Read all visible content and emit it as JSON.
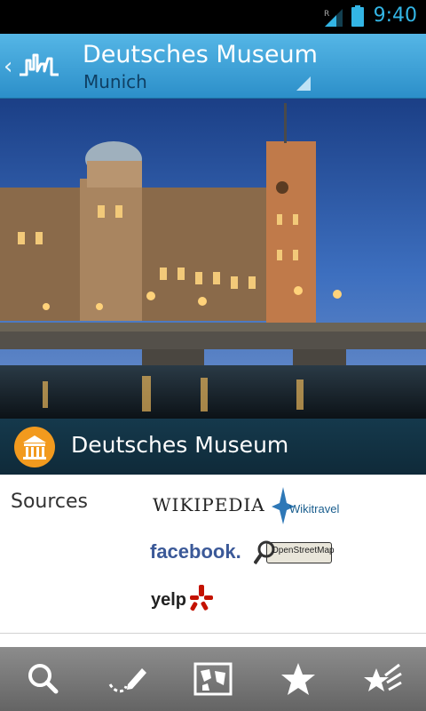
{
  "status_bar": {
    "time": "9:40",
    "roaming_label": "R"
  },
  "action_bar": {
    "title": "Deutsches Museum",
    "subtitle": "Munich"
  },
  "poi": {
    "name": "Deutsches Museum",
    "icon": "museum-icon"
  },
  "sources": {
    "label": "Sources",
    "items": [
      {
        "name": "wikipedia",
        "text": "WIKIPEDIA"
      },
      {
        "name": "wikitravel",
        "text": "Wikitravel"
      },
      {
        "name": "facebook",
        "text": "facebook."
      },
      {
        "name": "openstreetmap",
        "text": "OpenStreetMap"
      },
      {
        "name": "yelp",
        "text": "yelp"
      }
    ]
  },
  "bottom_tabs": [
    {
      "icon": "search-icon"
    },
    {
      "icon": "route-pencil-icon"
    },
    {
      "icon": "map-icon"
    },
    {
      "icon": "star-icon"
    },
    {
      "icon": "favorites-list-icon"
    }
  ],
  "colors": {
    "status_accent": "#33b5e5",
    "action_bar": "#3fa3d8",
    "poi_header": "#12323f",
    "museum_icon": "#f29a1e"
  }
}
